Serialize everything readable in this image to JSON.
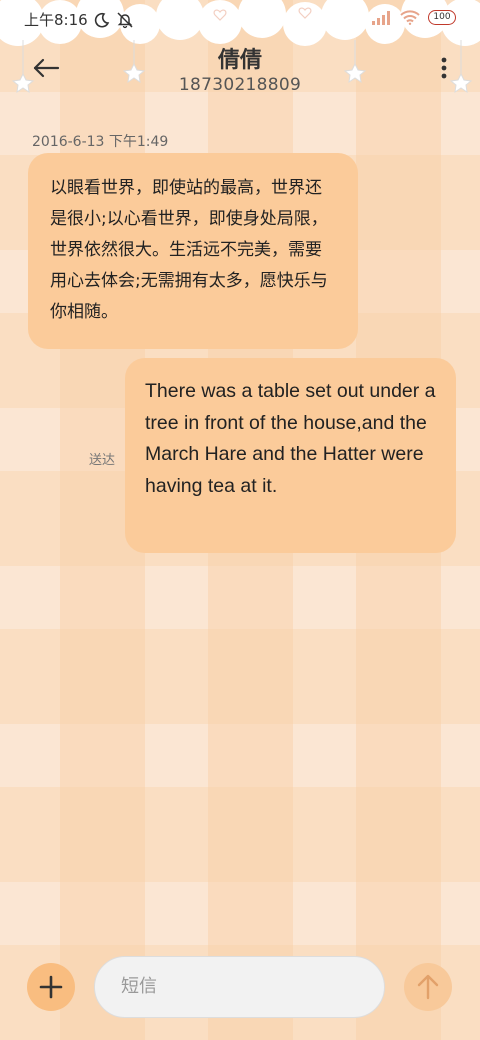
{
  "status_bar": {
    "time": "上午8:16",
    "battery": "100"
  },
  "header": {
    "contact_name": "倩倩",
    "phone_number": "18730218809"
  },
  "conversation": {
    "timestamp": "2016-6-13 下午1:49",
    "incoming_message": "以眼看世界，即使站的最高，世界还是很小;以心看世界，即使身处局限，世界依然很大。生活远不完美，需要用心去体会;无需拥有太多，愿快乐与你相随。",
    "outgoing_message": "There was a table set out under a tree in front of the house,and the March Hare and the Hatter were having tea at it.",
    "outgoing_status": "送达"
  },
  "composer": {
    "placeholder": "短信"
  },
  "colors": {
    "bubble": "#fbcb9a",
    "background": "#fbe6d3",
    "accent": "#f9bd80"
  },
  "icons": {
    "back": "arrow-left-icon",
    "more": "more-vertical-icon",
    "add": "plus-icon",
    "send": "arrow-up-icon",
    "moon": "moon-icon",
    "mute": "bell-off-icon",
    "signal": "signal-icon",
    "wifi": "wifi-icon"
  }
}
